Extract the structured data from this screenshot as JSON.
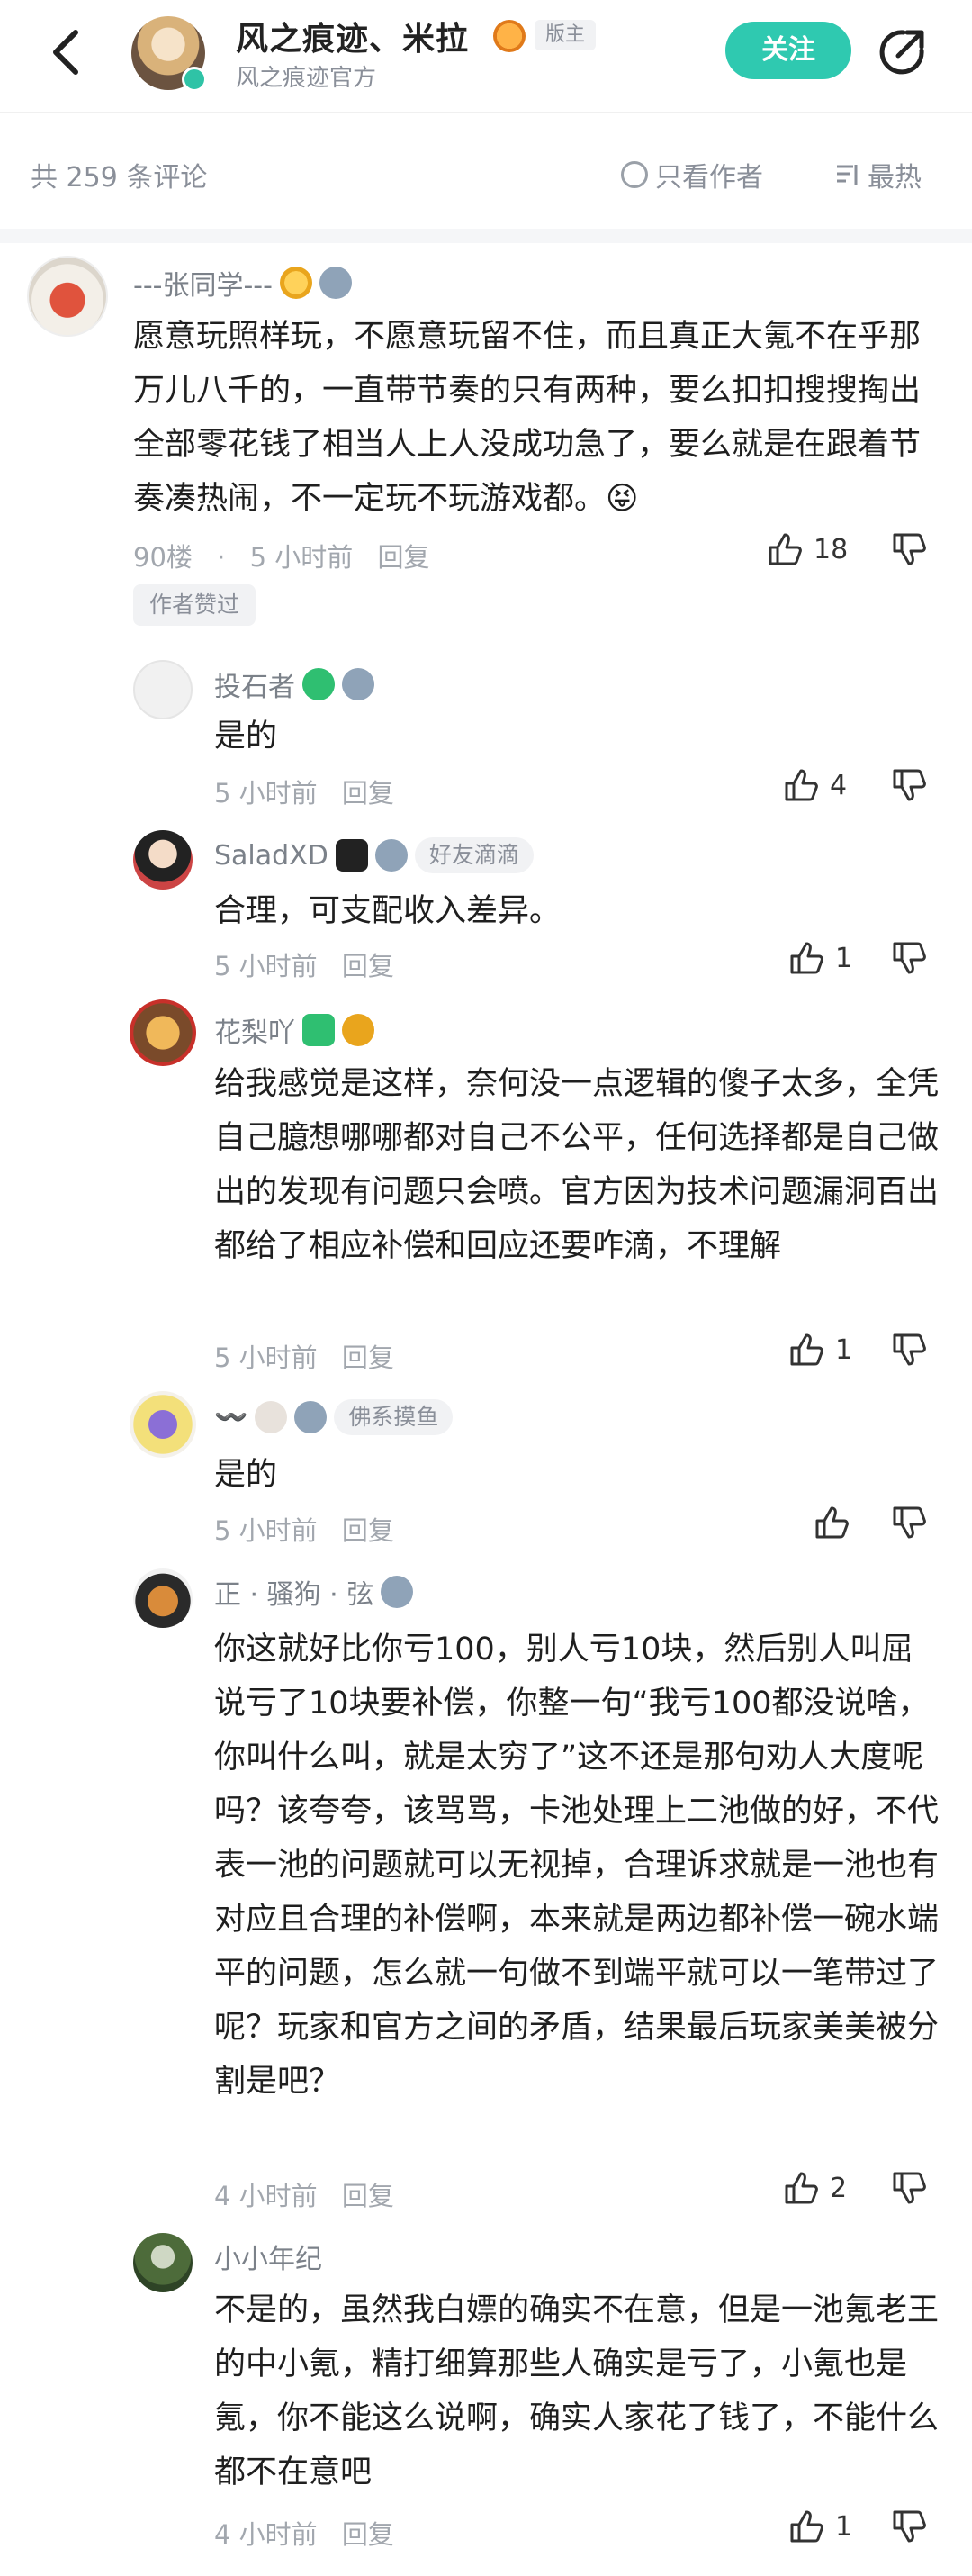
{
  "header": {
    "title": "风之痕迹、米拉",
    "role_tag": "版主",
    "subtitle": "风之痕迹官方",
    "follow_label": "关注"
  },
  "filter": {
    "count_label": "共 259 条评论",
    "only_author_label": "只看作者",
    "sort_label": "最热"
  },
  "main_comment": {
    "username": "---张同学---",
    "level": "2",
    "text": "愿意玩照样玩，不愿意玩留不住，而且真正大氪不在乎那万儿八千的，一直带节奏的只有两种，要么扣扣搜搜掏出全部零花钱了相当人上人没成功急了，要么就是在跟着节奏凑热闹，不一定玩不玩游戏都。",
    "emoji": "😝",
    "floor": "90楼",
    "dot": "·",
    "time": "5 小时前",
    "reply_label": "回复",
    "likes": "18",
    "liked_tag": "作者赞过"
  },
  "replies": [
    {
      "username": "投石者",
      "level": "2",
      "tag": "",
      "text": "是的",
      "time": "5 小时前",
      "reply_label": "回复",
      "likes": "4"
    },
    {
      "username": "SaladXD",
      "level": "3",
      "tag": "好友滴滴",
      "text": "合理，可支配收入差异。",
      "time": "5 小时前",
      "reply_label": "回复",
      "likes": "1"
    },
    {
      "username": "花梨吖",
      "level": "4",
      "tag": "",
      "text": "给我感觉是这样，奈何没一点逻辑的傻子太多，全凭自己臆想哪哪都对自己不公平，任何选择都是自己做出的发现有问题只会喷。官方因为技术问题漏洞百出都给了相应补偿和回应还要咋滴，不理解",
      "time": "5 小时前",
      "reply_label": "回复",
      "likes": "1"
    },
    {
      "username": "〰️",
      "level": "3",
      "tag": "佛系摸鱼",
      "text": "是的",
      "time": "5 小时前",
      "reply_label": "回复",
      "likes": ""
    },
    {
      "username": "正 · 骚狗 · 弦",
      "level": "1",
      "tag": "",
      "text": "你这就好比你亏100，别人亏10块，然后别人叫屈说亏了10块要补偿，你整一句“我亏100都没说啥，你叫什么叫，就是太穷了”这不还是那句劝人大度呢吗？该夸夸，该骂骂，卡池处理上二池做的好，不代表一池的问题就可以无视掉，合理诉求就是一池也有对应且合理的补偿啊，本来就是两边都补偿一碗水端平的问题，怎么就一句做不到端平就可以一笔带过了呢？玩家和官方之间的矛盾，结果最后玩家美美被分割是吧？",
      "time": "4 小时前",
      "reply_label": "回复",
      "likes": "2"
    },
    {
      "username": "小小年纪",
      "level": "",
      "tag": "",
      "text": "不是的，虽然我白嫖的确实不在意，但是一池氪老王的中小氪，精打细算那些人确实是亏了，小氪也是氪，你不能这么说啊，确实人家花了钱了，不能什么都不在意吧",
      "time": "4 小时前",
      "reply_label": "回复",
      "likes": "1"
    }
  ],
  "colors": {
    "accent": "#2fc9b0",
    "text_secondary": "#8a8f99",
    "text_primary": "#1f1f1f"
  }
}
